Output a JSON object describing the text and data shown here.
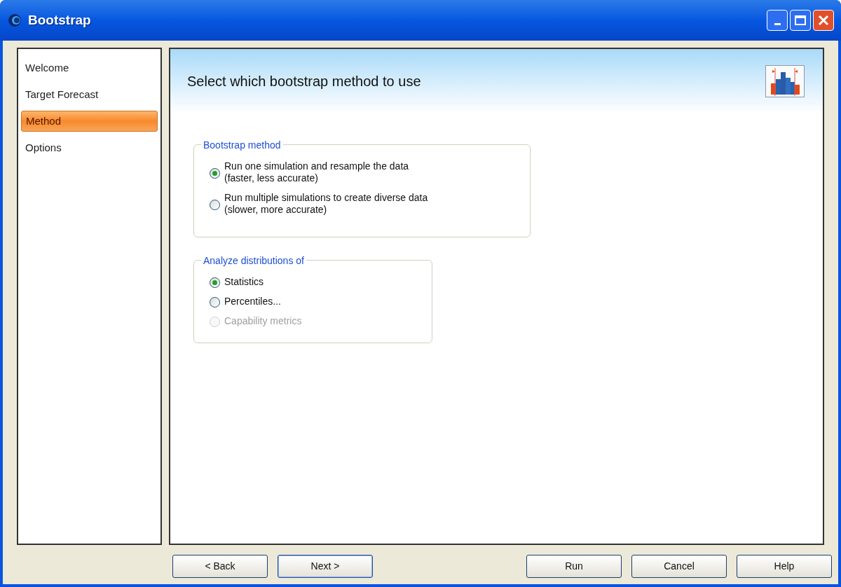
{
  "window": {
    "title": "Bootstrap"
  },
  "sidebar": {
    "items": [
      {
        "label": "Welcome",
        "selected": false
      },
      {
        "label": "Target Forecast",
        "selected": false
      },
      {
        "label": "Method",
        "selected": true
      },
      {
        "label": "Options",
        "selected": false
      }
    ]
  },
  "header": {
    "title": "Select which bootstrap method to use"
  },
  "groups": [
    {
      "title": "Bootstrap method",
      "options": [
        {
          "label": "Run one simulation and resample the data",
          "detail": "(faster, less accurate)",
          "selected": true,
          "disabled": false
        },
        {
          "label": "Run multiple simulations to create diverse data",
          "detail": "(slower, more accurate)",
          "selected": false,
          "disabled": false
        }
      ]
    },
    {
      "title": "Analyze distributions of",
      "options": [
        {
          "label": "Statistics",
          "selected": true,
          "disabled": false
        },
        {
          "label": "Percentiles...",
          "selected": false,
          "disabled": false
        },
        {
          "label": "Capability metrics",
          "selected": false,
          "disabled": true
        }
      ]
    }
  ],
  "buttons": [
    {
      "label": "< Back",
      "default": false
    },
    {
      "label": "Next >",
      "default": true
    },
    {
      "label": "Run",
      "default": false
    },
    {
      "label": "Cancel",
      "default": false
    },
    {
      "label": "Help",
      "default": false
    }
  ]
}
